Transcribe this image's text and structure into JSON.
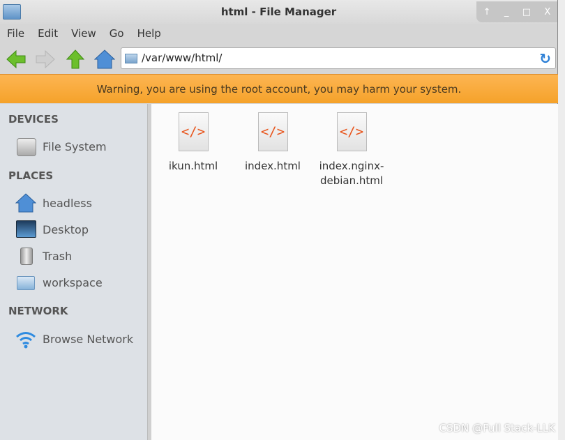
{
  "window": {
    "title": "html - File Manager",
    "controls": [
      "↑",
      "_",
      "□",
      "X"
    ]
  },
  "menu": [
    "File",
    "Edit",
    "View",
    "Go",
    "Help"
  ],
  "address": {
    "path": "/var/www/html/"
  },
  "warning": "Warning, you are using the root account, you may harm your system.",
  "sidebar": {
    "devices": {
      "heading": "DEVICES",
      "items": [
        {
          "label": "File System",
          "icon": "drive-icon"
        }
      ]
    },
    "places": {
      "heading": "PLACES",
      "items": [
        {
          "label": "headless",
          "icon": "home-icon"
        },
        {
          "label": "Desktop",
          "icon": "desktop-icon"
        },
        {
          "label": "Trash",
          "icon": "trash-icon"
        },
        {
          "label": "workspace",
          "icon": "folder-icon"
        }
      ]
    },
    "network": {
      "heading": "NETWORK",
      "items": [
        {
          "label": "Browse Network",
          "icon": "wifi-icon"
        }
      ]
    }
  },
  "files": [
    {
      "name": "ikun.html",
      "glyph": "</>"
    },
    {
      "name": "index.html",
      "glyph": "</>"
    },
    {
      "name": "index.nginx-debian.html",
      "glyph": "</>"
    }
  ],
  "watermark": "CSDN @Full Stack-LLK",
  "colors": {
    "warning": "#f9ab3c",
    "accent": "#2c7fd6",
    "html_icon": "#e8561e"
  }
}
